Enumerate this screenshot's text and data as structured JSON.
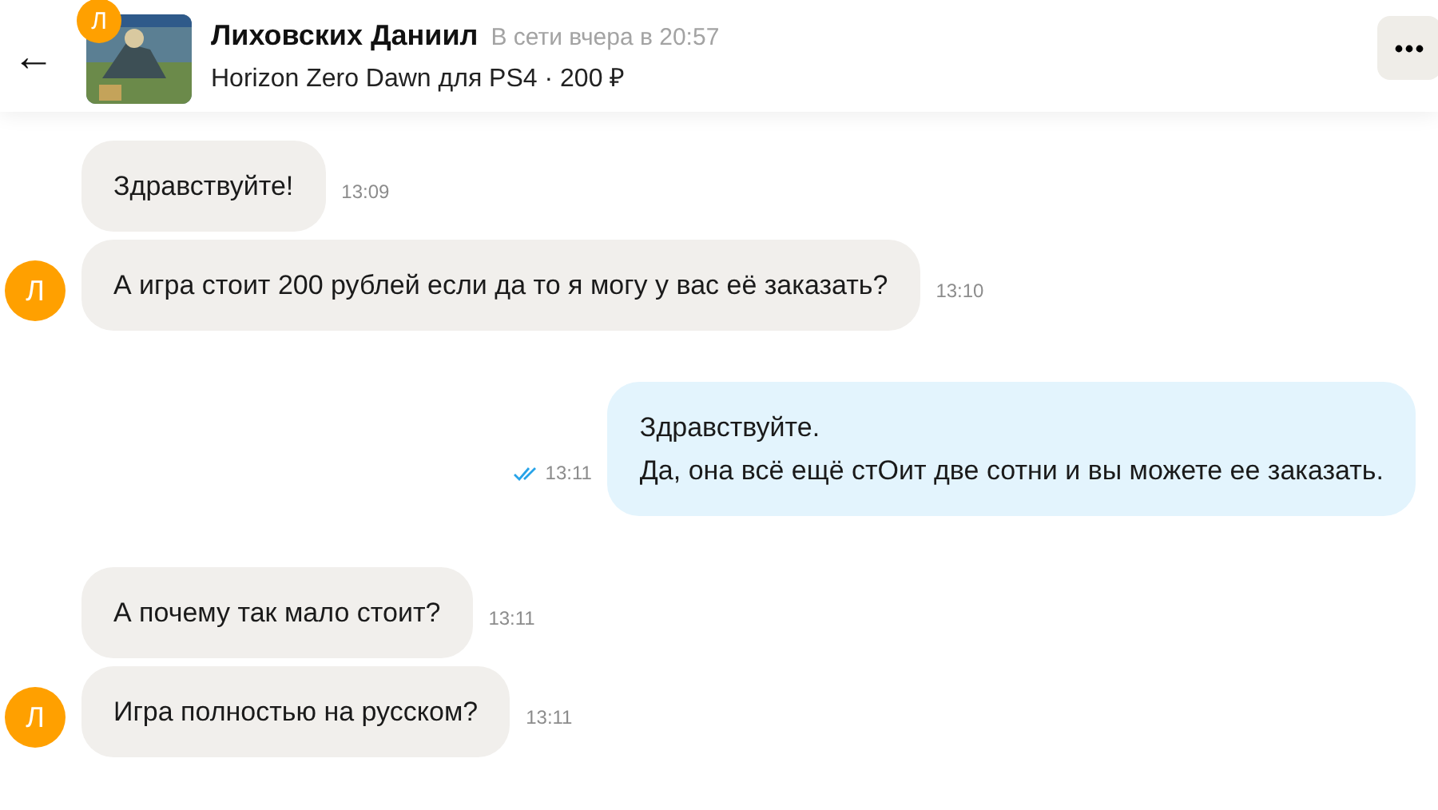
{
  "header": {
    "back": "←",
    "listing_badge": "Л",
    "name": "Лиховских Даниил",
    "status": "В сети вчера в 20:57",
    "listing": "Horizon Zero Dawn для PS4 · 200 ₽"
  },
  "groups": [
    {
      "kind": "received",
      "avatar": "Л",
      "messages": [
        {
          "text": "Здравствуйте!",
          "time": "13:09"
        },
        {
          "text": "А игра стоит 200 рублей если да то я могу у вас её заказать?",
          "time": "13:10"
        }
      ]
    },
    {
      "kind": "sent",
      "messages": [
        {
          "text": "Здравствуйте.\nДа, она всё ещё стОит две сотни и вы можете ее заказать.",
          "time": "13:11",
          "read": true
        }
      ]
    },
    {
      "kind": "received",
      "avatar": "Л",
      "messages": [
        {
          "text": "А почему так мало стоит?",
          "time": "13:11"
        },
        {
          "text": "Игра полностью на русском?",
          "time": "13:11"
        }
      ]
    }
  ]
}
